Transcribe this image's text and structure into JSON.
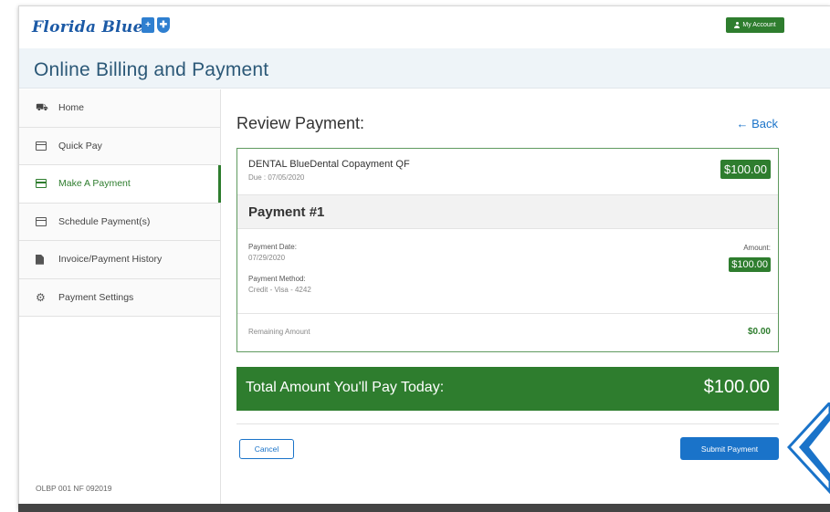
{
  "header": {
    "logo_text": "Florida Blue",
    "my_account_label": "My Account"
  },
  "page": {
    "title": "Online Billing and Payment"
  },
  "sidebar": {
    "items": [
      {
        "label": "Home",
        "icon": "home-icon"
      },
      {
        "label": "Quick Pay",
        "icon": "credit-card-icon"
      },
      {
        "label": "Make A Payment",
        "icon": "credit-card-icon",
        "active": true
      },
      {
        "label": "Schedule Payment(s)",
        "icon": "credit-card-icon"
      },
      {
        "label": "Invoice/Payment History",
        "icon": "document-icon"
      },
      {
        "label": "Payment Settings",
        "icon": "gear-icon"
      }
    ],
    "footer": "OLBP 001 NF 092019"
  },
  "review": {
    "title": "Review Payment:",
    "back_label": "← Back",
    "item_name": "DENTAL BlueDental Copayment QF",
    "item_due": "Due : 07/05/2020",
    "item_amount": "$100.00",
    "payment_title": "Payment #1",
    "payment_date_label": "Payment Date:",
    "payment_date": "07/29/2020",
    "payment_method_label": "Payment Method:",
    "payment_method": "Credit - Visa - 4242",
    "amount_label": "Amount:",
    "amount": "$100.00",
    "remaining_label": "Remaining Amount",
    "remaining_value": "$0.00",
    "total_label": "Total Amount You'll Pay Today:",
    "total_value": "$100.00",
    "cancel_label": "Cancel",
    "submit_label": "Submit Payment"
  },
  "colors": {
    "brand_green": "#2e7d2e",
    "brand_blue": "#1a73c9",
    "title_blue": "#2b5877"
  }
}
